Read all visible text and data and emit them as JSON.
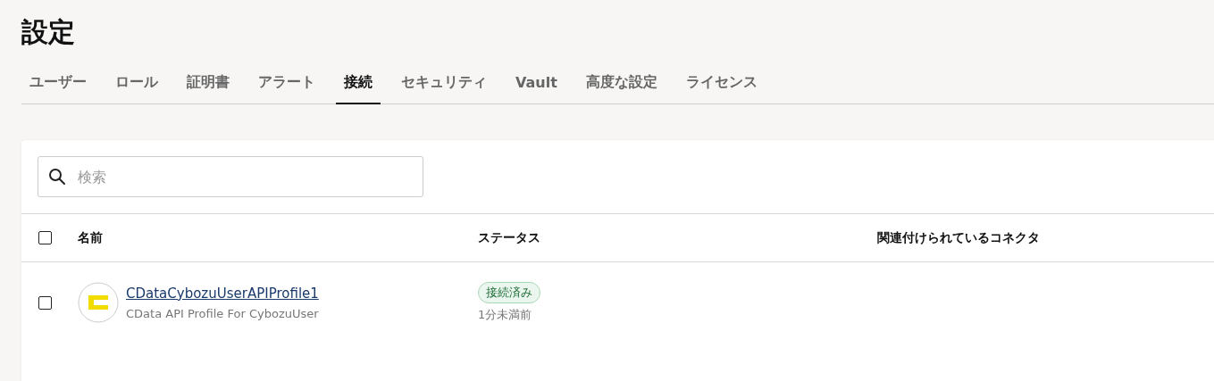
{
  "page": {
    "title": "設定"
  },
  "tabs": [
    {
      "label": "ユーザー",
      "selected": false
    },
    {
      "label": "ロール",
      "selected": false
    },
    {
      "label": "証明書",
      "selected": false
    },
    {
      "label": "アラート",
      "selected": false
    },
    {
      "label": "接続",
      "selected": true
    },
    {
      "label": "セキュリティ",
      "selected": false
    },
    {
      "label": "Vault",
      "selected": false
    },
    {
      "label": "高度な設定",
      "selected": false
    },
    {
      "label": "ライセンス",
      "selected": false
    }
  ],
  "search": {
    "placeholder": "検索"
  },
  "table": {
    "header_checked": false,
    "columns": [
      "名前",
      "ステータス",
      "関連付けられているコネクタ"
    ],
    "rows": [
      {
        "checked": false,
        "name": "CDataCybozuUserAPIProfile1",
        "description": "CData API Profile For CybozuUser",
        "status": "接続済み",
        "time": "1分未満前"
      }
    ]
  }
}
